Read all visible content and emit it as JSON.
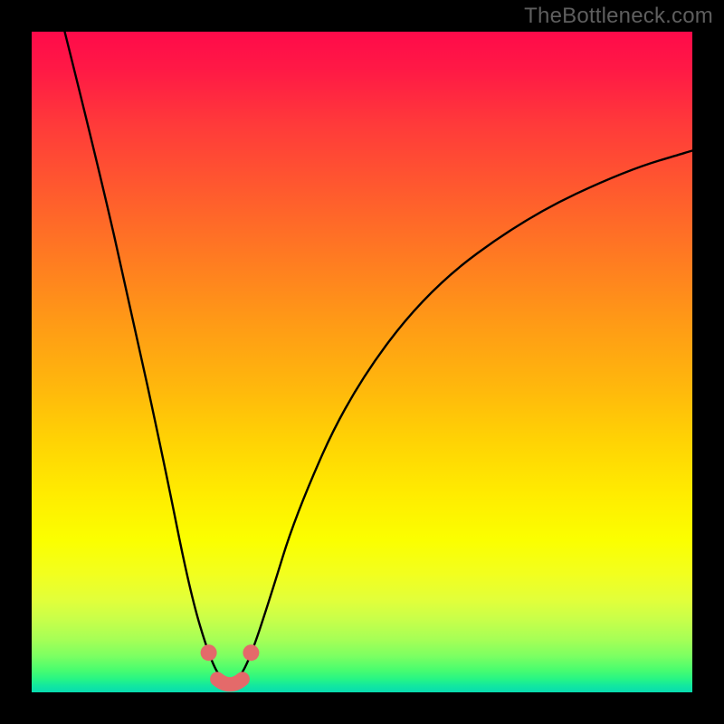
{
  "watermark": "TheBottleneck.com",
  "chart_data": {
    "type": "line",
    "title": "",
    "xlabel": "",
    "ylabel": "",
    "xlim": [
      0,
      1
    ],
    "ylim": [
      0,
      1
    ],
    "series": [
      {
        "name": "bottleneck-curve",
        "description": "V-shaped curve: steep descent from top-left to a flat minimum near x≈0.30, then a broad rise toward the right edge",
        "x": [
          0.05,
          0.1,
          0.15,
          0.2,
          0.24,
          0.27,
          0.29,
          0.31,
          0.33,
          0.36,
          0.4,
          0.48,
          0.6,
          0.75,
          0.9,
          1.0
        ],
        "y": [
          1.0,
          0.8,
          0.58,
          0.35,
          0.15,
          0.05,
          0.015,
          0.015,
          0.05,
          0.14,
          0.27,
          0.45,
          0.61,
          0.72,
          0.79,
          0.82
        ]
      },
      {
        "name": "minimum-marker",
        "description": "Small salmon U-shaped highlight at the curve's minimum, flanked by two dots on the curve arms just above it",
        "x": [
          0.268,
          0.281,
          0.3,
          0.319,
          0.332
        ],
        "y": [
          0.06,
          0.02,
          0.012,
          0.02,
          0.06
        ]
      }
    ],
    "gradient_stops": [
      {
        "pos": 0.0,
        "color": "#ff0a4a"
      },
      {
        "pos": 0.34,
        "color": "#ff7a22"
      },
      {
        "pos": 0.7,
        "color": "#ffec00"
      },
      {
        "pos": 0.92,
        "color": "#a6ff56"
      },
      {
        "pos": 1.0,
        "color": "#08dcb0"
      }
    ]
  }
}
